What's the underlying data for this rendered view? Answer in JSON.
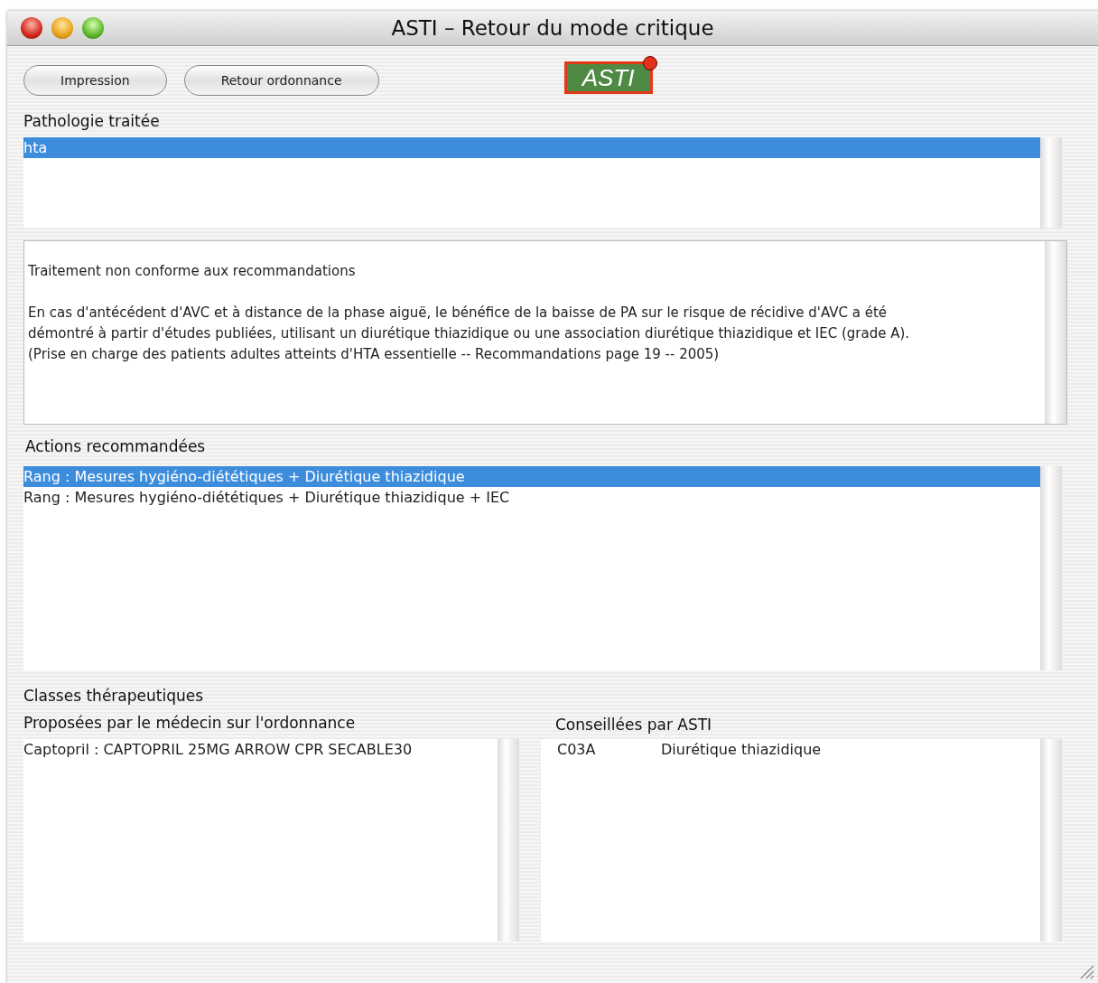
{
  "window": {
    "title": "ASTI – Retour du mode critique"
  },
  "toolbar": {
    "buttons": [
      "Impression",
      "Retour ordonnance"
    ],
    "logo": "ASTI"
  },
  "pathologie": {
    "label": "Pathologie traitée",
    "items": [
      {
        "text": "hta",
        "selected": true
      }
    ]
  },
  "message": {
    "lines": [
      {
        "kind": "text",
        "text": "Traitement non conforme aux recommandations"
      },
      {
        "kind": "gap"
      },
      {
        "kind": "text",
        "text": "En cas d'antécédent d'AVC et à distance de la phase aiguë, le bénéfice de la baisse de PA sur le risque de récidive d'AVC a été"
      },
      {
        "kind": "text",
        "text": "démontré à partir d'études publiées, utilisant un diurétique thiazidique ou une association diurétique thiazidique et IEC (grade A)."
      },
      {
        "kind": "text",
        "text": "  (Prise en charge des patients adultes atteints d'HTA essentielle -- Recommandations page 19 -- 2005)"
      }
    ]
  },
  "actions": {
    "label": "Actions recommandées",
    "items": [
      {
        "text": "Rang  : Mesures hygiéno-diététiques + Diurétique thiazidique",
        "selected": true
      },
      {
        "text": "Rang  : Mesures hygiéno-diététiques + Diurétique thiazidique + IEC",
        "selected": false
      }
    ]
  },
  "classes": {
    "label": "Classes thérapeutiques",
    "proposees": {
      "label": "Proposées par le médecin sur l'ordonnance",
      "items": [
        {
          "text": "Captopril : CAPTOPRIL 25MG ARROW CPR SECABLE30"
        }
      ]
    },
    "conseillees": {
      "label": "Conseillées par ASTI",
      "items": [
        {
          "code": "C03A",
          "text": "Diurétique thiazidique"
        }
      ]
    }
  }
}
